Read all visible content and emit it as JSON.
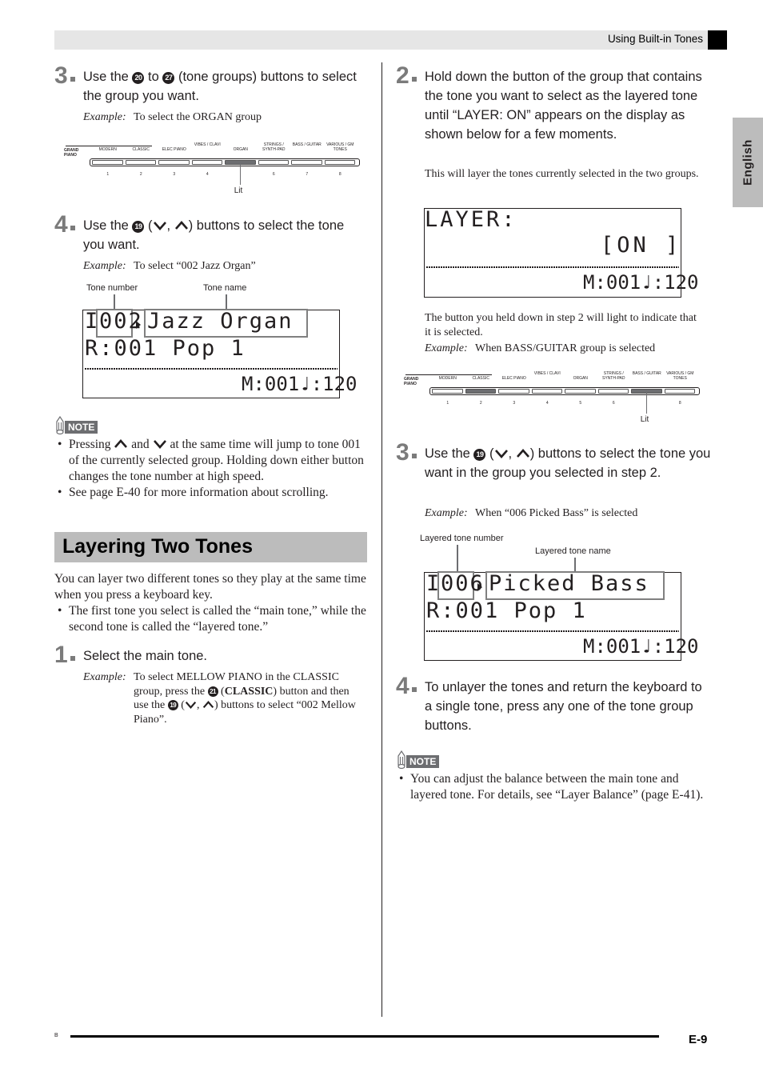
{
  "header": {
    "title": "Using Built-in Tones"
  },
  "side_tab": {
    "label": "English"
  },
  "icons": {
    "down": "chevron-down-icon",
    "up": "chevron-up-icon",
    "note": "pencil-note-icon"
  },
  "left": {
    "step3": {
      "number": "3",
      "text_a": "Use the ",
      "btn_a": "20",
      "text_b": " to ",
      "btn_b": "27",
      "text_c": " (tone groups) buttons to select the group you want.",
      "example_label": "Example:",
      "example_text": "To select the ORGAN group"
    },
    "tone_groups_1": {
      "grand_piano": "GRAND PIANO",
      "labels": [
        "MODERN",
        "CLASSIC",
        "ELEC PIANO",
        "VIBES / CLAVI",
        "ORGAN",
        "STRINGS / SYNTH-PAD",
        "BASS / GUITAR",
        "VARIOUS / GM TONES"
      ],
      "numbers": [
        "1",
        "2",
        "3",
        "4",
        "",
        "6",
        "7",
        "8"
      ],
      "lit_index": 4,
      "lit_label": "Lit"
    },
    "step4": {
      "number": "4",
      "text_a": "Use the ",
      "btn": "19",
      "text_b": " (",
      "text_c": ", ",
      "text_d": ") buttons to select the tone you want.",
      "example_label": "Example:",
      "example_text": "To select “002 Jazz Organ”"
    },
    "display_1": {
      "callout_number": "Tone number",
      "callout_name": "Tone name",
      "row1_prefix": "I",
      "row1_number": "002",
      "row1_name": "Jazz Organ",
      "row2": "R:001 Pop 1",
      "status": "M:001♩:120"
    },
    "note": {
      "label": "NOTE",
      "bullet1_a": "Pressing ",
      "bullet1_b": " and ",
      "bullet1_c": " at the same time will jump to tone 001 of the currently selected group. Holding down either button changes the tone number at high speed.",
      "bullet2": "See page E-40 for more information about scrolling."
    },
    "section": {
      "title": "Layering Two Tones",
      "intro": "You can layer two different tones so they play at the same time when you press a keyboard key.",
      "bullet": "The first tone you select is called the “main tone,” while the second tone is called the “layered tone.”"
    },
    "step1": {
      "number": "1",
      "text": "Select the main tone.",
      "example_label": "Example:",
      "example_a": "To select MELLOW PIANO in the CLASSIC group, press the ",
      "btn_a": "21",
      "example_b": " (",
      "example_bold": "CLASSIC",
      "example_c": ") button and then use the ",
      "btn_b": "19",
      "example_d": " (",
      "example_e": ", ",
      "example_f": ") buttons to select “002 Mellow Piano”."
    }
  },
  "right": {
    "step2": {
      "number": "2",
      "text": "Hold down the button of the group that contains the tone you want to select as the layered tone until “LAYER: ON” appears on the display as shown below for a few moments.",
      "subtext": "This will layer the tones currently selected in the two groups."
    },
    "display_layer": {
      "row1": "LAYER:",
      "row2": "[ON ]",
      "status": "M:001♩:120"
    },
    "lit_text": "The button you held down in step 2 will light to indicate that it is selected.",
    "lit_example_label": "Example:",
    "lit_example_text": "When BASS/GUITAR group is selected",
    "tone_groups_2": {
      "grand_piano": "GRAND PIANO",
      "labels": [
        "MODERN",
        "CLASSIC",
        "ELEC PIANO",
        "VIBES / CLAVI",
        "ORGAN",
        "STRINGS / SYNTH-PAD",
        "BASS / GUITAR",
        "VARIOUS / GM TONES"
      ],
      "numbers": [
        "1",
        "2",
        "3",
        "4",
        "5",
        "6",
        "",
        "8"
      ],
      "lit_indices": [
        1,
        6
      ],
      "lit_label": "Lit"
    },
    "step3": {
      "number": "3",
      "text_a": "Use the ",
      "btn": "19",
      "text_b": " (",
      "text_c": ", ",
      "text_d": ") buttons to select the tone you want in the group you selected in step 2.",
      "example_label": "Example:",
      "example_text": "When “006 Picked Bass” is selected"
    },
    "display_2": {
      "callout_number": "Layered tone number",
      "callout_name": "Layered tone name",
      "row1_prefix": "I",
      "row1_number": "006",
      "row1_name": "Picked Bass",
      "row2": "R:001 Pop 1",
      "status": "M:001♩:120"
    },
    "step4": {
      "number": "4",
      "text": "To unlayer the tones and return the keyboard to a single tone, press any one of the tone group buttons."
    },
    "note": {
      "label": "NOTE",
      "bullet": "You can adjust the balance between the main tone and layered tone. For details, see “Layer Balance” (page E-41)."
    }
  },
  "footer": {
    "marker": "B",
    "page": "E-9"
  }
}
